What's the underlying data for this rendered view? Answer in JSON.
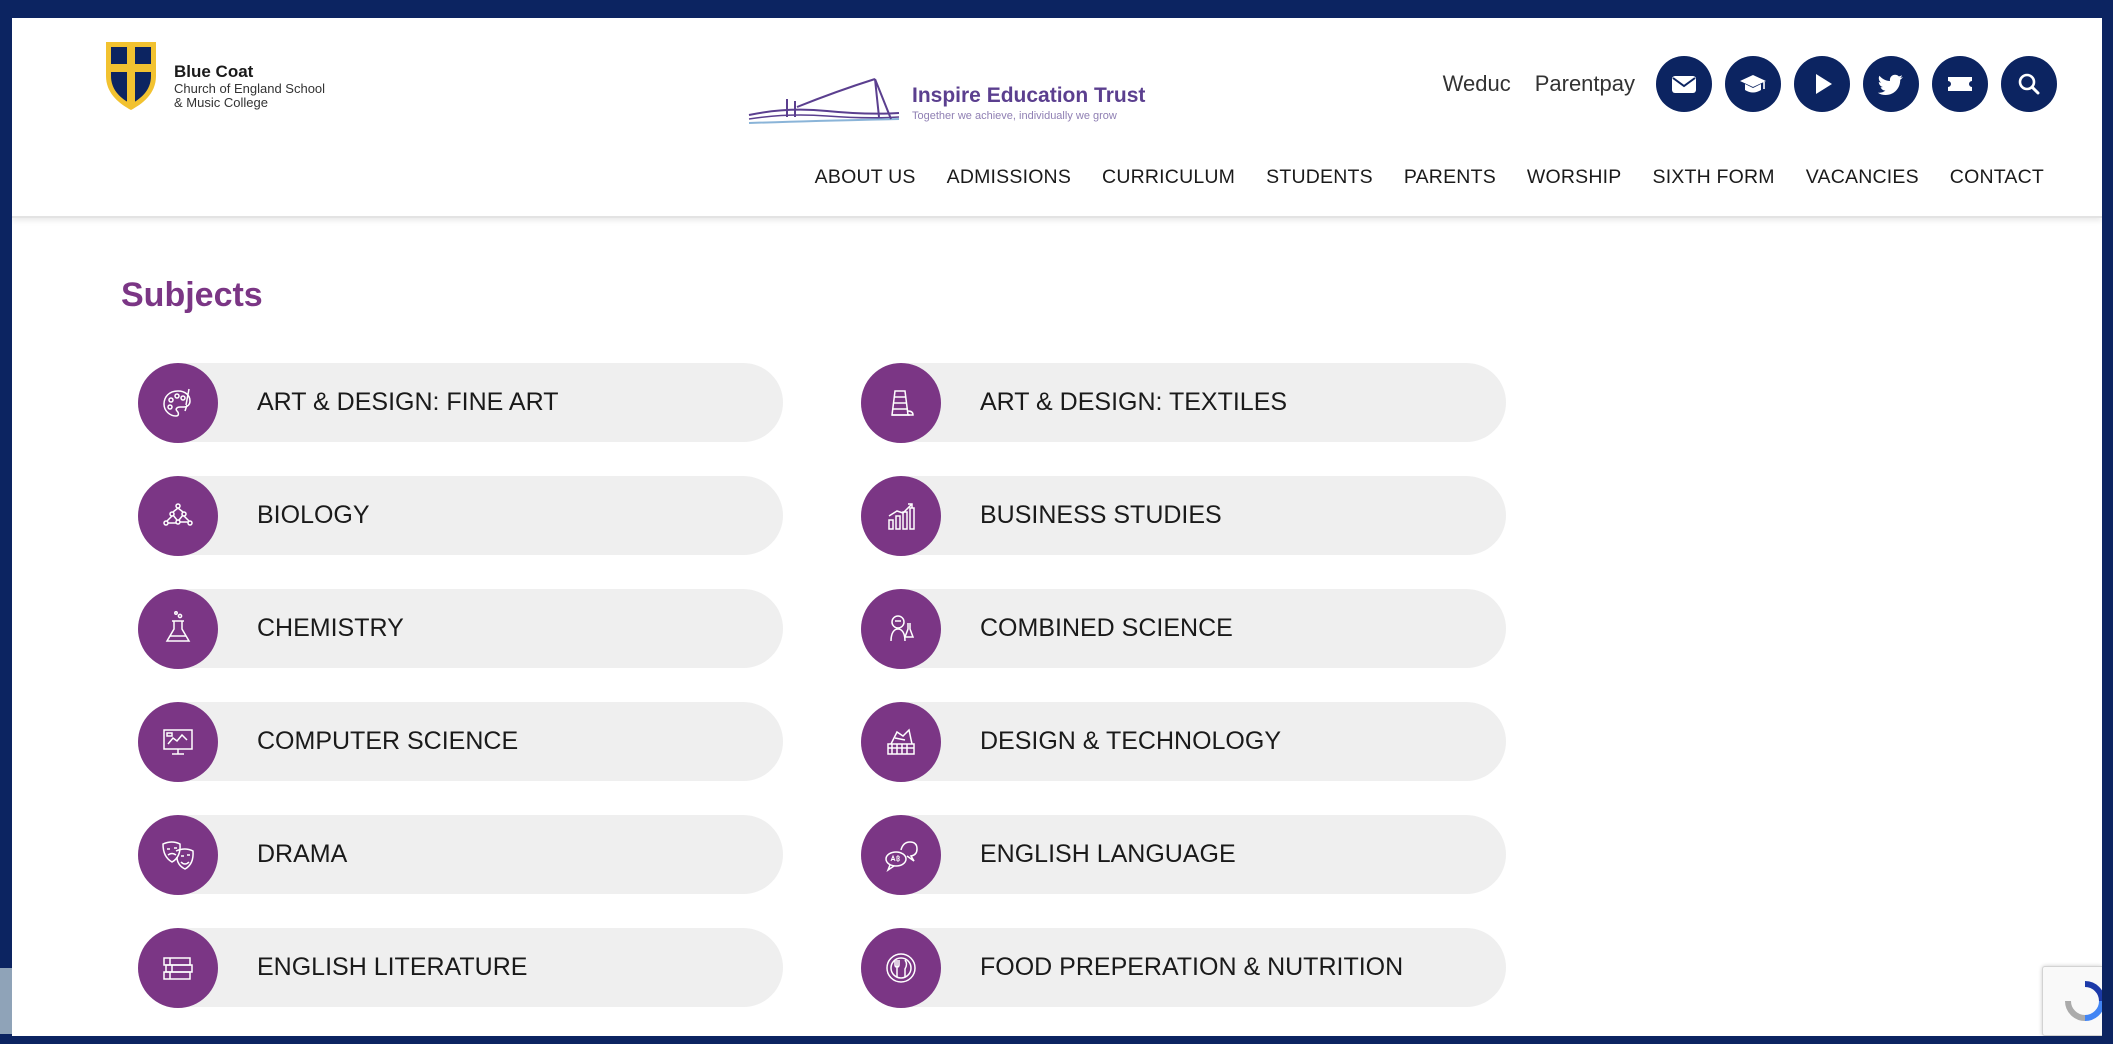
{
  "header": {
    "school": {
      "name": "Blue Coat",
      "line1": "Church of England School",
      "line2": "& Music College"
    },
    "trust": {
      "name": "Inspire Education Trust",
      "tagline": "Together we achieve, individually we grow"
    },
    "top_links": [
      "Weduc",
      "Parentpay"
    ],
    "icon_buttons": [
      "envelope-icon",
      "graduation-cap-icon",
      "play-icon",
      "twitter-icon",
      "ticket-icon",
      "search-icon"
    ]
  },
  "nav": {
    "items": [
      "ABOUT US",
      "ADMISSIONS",
      "CURRICULUM",
      "STUDENTS",
      "PARENTS",
      "WORSHIP",
      "SIXTH FORM",
      "VACANCIES",
      "CONTACT"
    ]
  },
  "main": {
    "title": "Subjects",
    "subjects": [
      {
        "label": "ART & DESIGN: FINE ART",
        "icon": "palette-icon"
      },
      {
        "label": "ART & DESIGN: TEXTILES",
        "icon": "thread-spool-icon"
      },
      {
        "label": "BIOLOGY",
        "icon": "molecule-icon"
      },
      {
        "label": "BUSINESS STUDIES",
        "icon": "growth-chart-icon"
      },
      {
        "label": "CHEMISTRY",
        "icon": "flask-icon"
      },
      {
        "label": "COMBINED SCIENCE",
        "icon": "scientist-icon"
      },
      {
        "label": "COMPUTER SCIENCE",
        "icon": "monitor-icon"
      },
      {
        "label": "DESIGN & TECHNOLOGY",
        "icon": "toolbox-icon"
      },
      {
        "label": "DRAMA",
        "icon": "theatre-masks-icon"
      },
      {
        "label": "ENGLISH LANGUAGE",
        "icon": "speech-bubbles-icon"
      },
      {
        "label": "ENGLISH LITERATURE",
        "icon": "books-icon"
      },
      {
        "label": "FOOD PREPERATION & NUTRITION",
        "icon": "plate-cutlery-icon"
      }
    ]
  },
  "colors": {
    "frame": "#0c2461",
    "accent_purple": "#7b3685",
    "pill_bg": "#efefef",
    "trust_purple": "#5b3f8f"
  }
}
